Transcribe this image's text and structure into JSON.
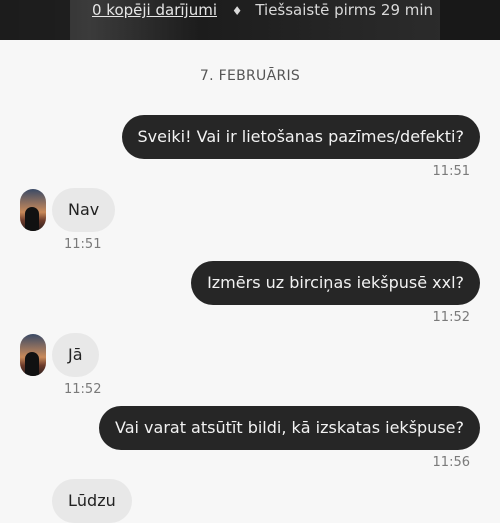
{
  "header": {
    "deals_link": "0 kopēji darījumi",
    "separator": "♦",
    "online_status": "Tiešsaistē pirms 29 min"
  },
  "chat": {
    "date_label": "7. FEBRUĀRIS",
    "messages": [
      {
        "direction": "out",
        "text": "Sveiki! Vai ir lietošanas pazīmes/defekti?",
        "time": "11:51"
      },
      {
        "direction": "in",
        "text": "Nav",
        "time": "11:51"
      },
      {
        "direction": "out",
        "text": "Izmērs uz birciņas iekšpusē xxl?",
        "time": "11:52"
      },
      {
        "direction": "in",
        "text": "Jā",
        "time": "11:52"
      },
      {
        "direction": "out",
        "text": "Vai varat atsūtīt bildi, kā izskatas iekšpuse?",
        "time": "11:56"
      },
      {
        "direction": "in",
        "text": "Lūdzu",
        "time": ""
      }
    ]
  },
  "colors": {
    "outgoing_bubble": "#262626",
    "incoming_bubble": "#e8e8e8",
    "background": "#f7f7f7"
  },
  "icons": {
    "avatar": "seller-avatar"
  }
}
